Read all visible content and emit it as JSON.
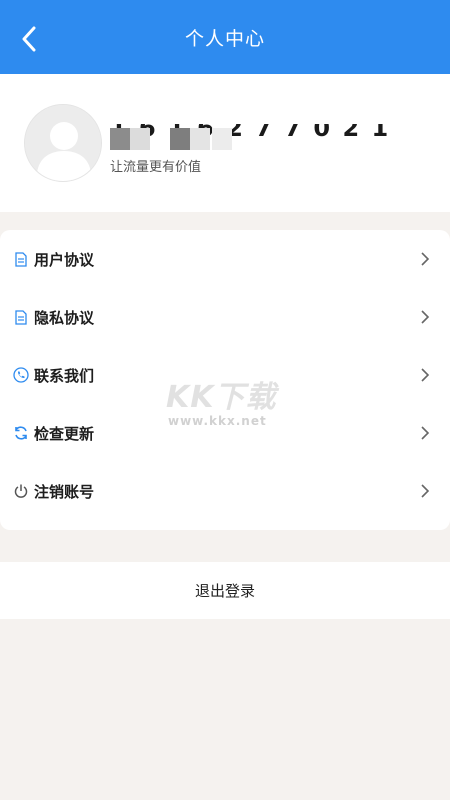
{
  "header": {
    "title": "个人中心",
    "color": "#2e8bef"
  },
  "profile": {
    "phone_masked": "1 6 1 6 2 7 7 0 2 1",
    "tagline": "让流量更有价值"
  },
  "menu": {
    "items": [
      {
        "label": "用户协议",
        "icon": "document-icon"
      },
      {
        "label": "隐私协议",
        "icon": "document-icon"
      },
      {
        "label": "联系我们",
        "icon": "phone-icon"
      },
      {
        "label": "检查更新",
        "icon": "refresh-icon"
      },
      {
        "label": "注销账号",
        "icon": "power-icon"
      }
    ]
  },
  "logout": {
    "label": "退出登录"
  },
  "watermark": {
    "logo": "KK下载",
    "url": "www.kkx.net"
  }
}
